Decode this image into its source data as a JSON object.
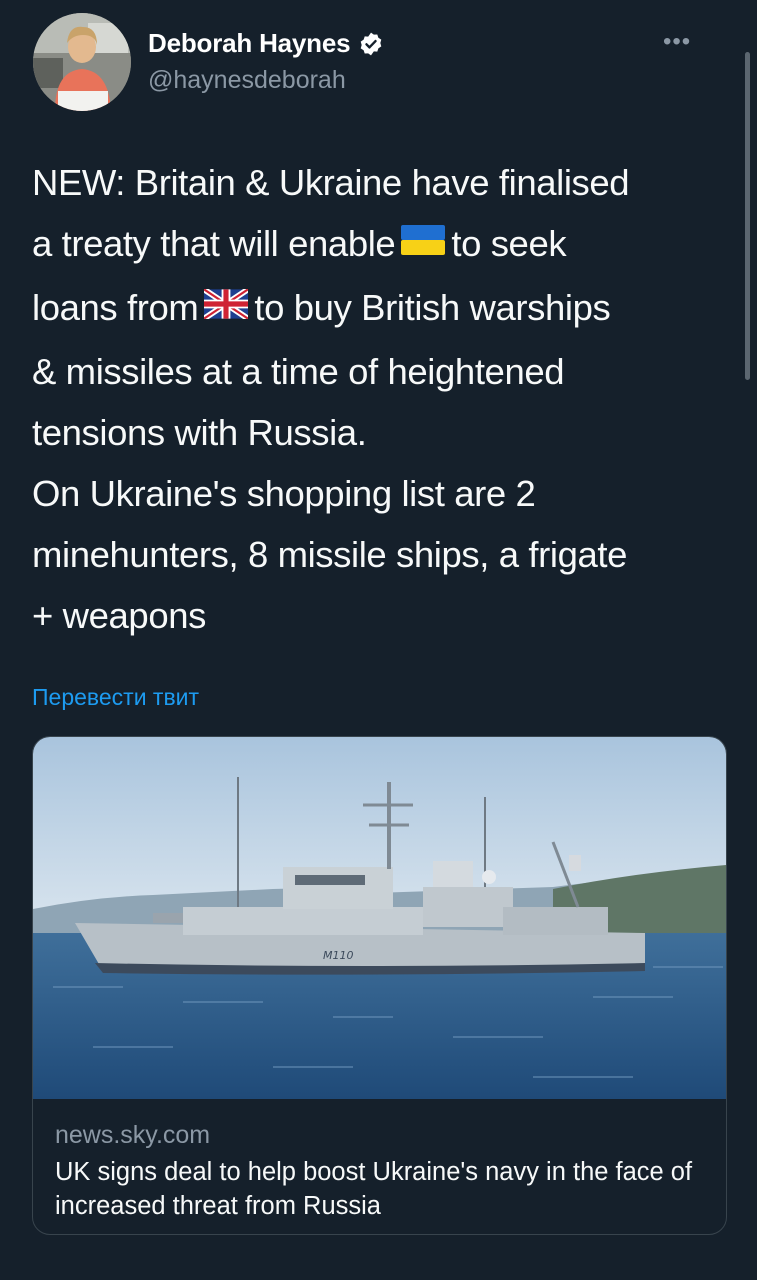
{
  "author": {
    "display_name": "Deborah Haynes",
    "handle": "@haynesdeborah",
    "verified": true
  },
  "more_label": "•••",
  "tweet": {
    "lines": [
      "NEW: Britain & Ukraine have finalised",
      "a treaty that will enable",
      "to seek",
      "loans from",
      "to buy British warships",
      "& missiles at a time of heightened",
      "tensions with Russia.",
      "On Ukraine's shopping list are 2",
      "minehunters, 8 missile ships, a frigate",
      "+ weapons"
    ],
    "emoji": [
      "ukraine-flag",
      "uk-flag"
    ]
  },
  "translate_label": "Перевести твит",
  "link_card": {
    "image_hull_number": "M110",
    "domain": "news.sky.com",
    "title": "UK signs deal to help boost Ukraine's navy in the face of increased threat from Russia"
  },
  "colors": {
    "background": "#15202b",
    "accent": "#1d9bf0",
    "secondary_text": "#8b98a5",
    "verified_badge": "#ffffff"
  }
}
